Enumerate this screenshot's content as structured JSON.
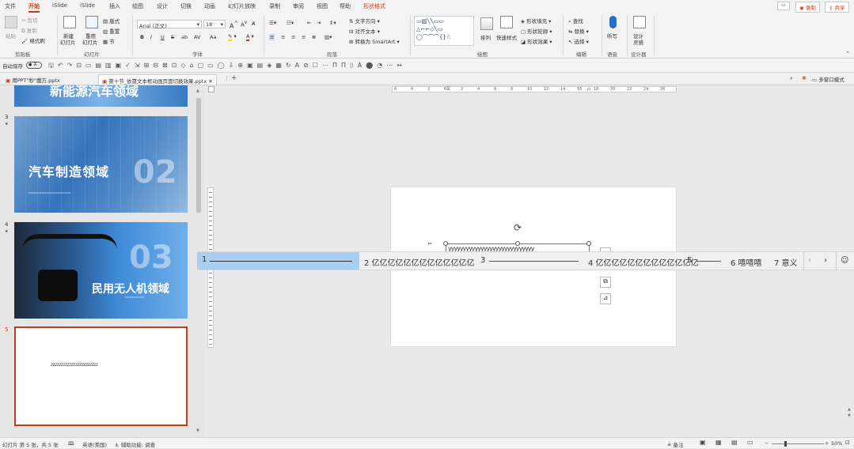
{
  "menu_tabs": [
    "文件",
    "开始",
    "iSlide",
    "iSlide",
    "插入",
    "绘图",
    "设计",
    "切换",
    "动画",
    "幻灯片放映",
    "录制",
    "审阅",
    "视图",
    "帮助",
    "形状格式"
  ],
  "record_label": "录制",
  "share_label": "共享",
  "clipboard": {
    "paste": "粘贴",
    "cut": "剪切",
    "copy": "复制",
    "format_painter": "格式刷",
    "label": "剪贴板"
  },
  "slides_group": {
    "new_slide": "新建",
    "new_slide2": "幻灯片",
    "reuse": "重用",
    "reuse2": "幻灯片",
    "layout": "版式",
    "reset": "重置",
    "section": "节",
    "label": "幻灯片"
  },
  "font_group": {
    "font_name": "Arial (正文)",
    "font_size": "18",
    "bold": "B",
    "italic": "I",
    "underline": "U",
    "strike": "S",
    "shadow": "ab",
    "spacing": "AV",
    "case": "Aa",
    "label": "字体"
  },
  "paragraph_group": {
    "text_direction": "文字方向",
    "align_text": "对齐文本",
    "smartart": "转换为 SmartArt",
    "label": "段落"
  },
  "drawing_group": {
    "arrange": "排列",
    "quick_styles": "快速样式",
    "shape_fill": "形状填充",
    "shape_outline": "形状轮廓",
    "shape_effects": "形状效果",
    "label": "绘图"
  },
  "editing_group": {
    "find": "查找",
    "replace": "替换",
    "select": "选择",
    "label": "编辑"
  },
  "voice_group": {
    "dictate": "听写",
    "label": "语音"
  },
  "designer_group": {
    "designer": "设计",
    "designer2": "灵感",
    "label": "设计器"
  },
  "autosave": {
    "label": "自动保存",
    "state": "关"
  },
  "doc_tabs": [
    {
      "title": "用PPT\"秒\"魔方.pptx"
    },
    {
      "title": "第十节_依靠文本框动画页面切换效果.pptx"
    }
  ],
  "multi_window": "多窗口模式",
  "slides": [
    {
      "num": "3",
      "title": "汽车制造领域",
      "big_num": "02",
      "sub": "XXXXXXXXXXXXXXXXXXXXXXXXXX"
    },
    {
      "num": "4",
      "title": "民用无人机领域",
      "big_num": "03",
      "sub": "XXXXXXXXXXXX"
    },
    {
      "num": "5",
      "text": "ZZZZZZZZZZZZZZZZZZZZZZZ"
    }
  ],
  "top_slide_title": "新能源汽车领域",
  "ruler_labels": [
    "6",
    "4",
    "2",
    "0",
    "2",
    "4",
    "6",
    "8",
    "10",
    "12",
    "14",
    "16",
    "18",
    "20",
    "22",
    "24",
    "26"
  ],
  "textbox_content": "yyyyyyyyyyyyyyyyyyyyyyyyyyyyy",
  "ime": {
    "input": "1",
    "candidates": [
      "2 亿亿亿亿亿亿亿亿亿亿亿亿亿",
      "3",
      "4 亿亿亿亿亿亿亿亿亿亿亿亿亿",
      "5",
      "6 嘻嘻嘻",
      "7 意义"
    ],
    "emoji": "☺"
  },
  "status": {
    "slide_info": "幻灯片 第 5 张，共 5 张",
    "language": "英语(美国)",
    "accessibility": "辅助功能: 调查",
    "notes": "备注",
    "zoom": "50%"
  }
}
